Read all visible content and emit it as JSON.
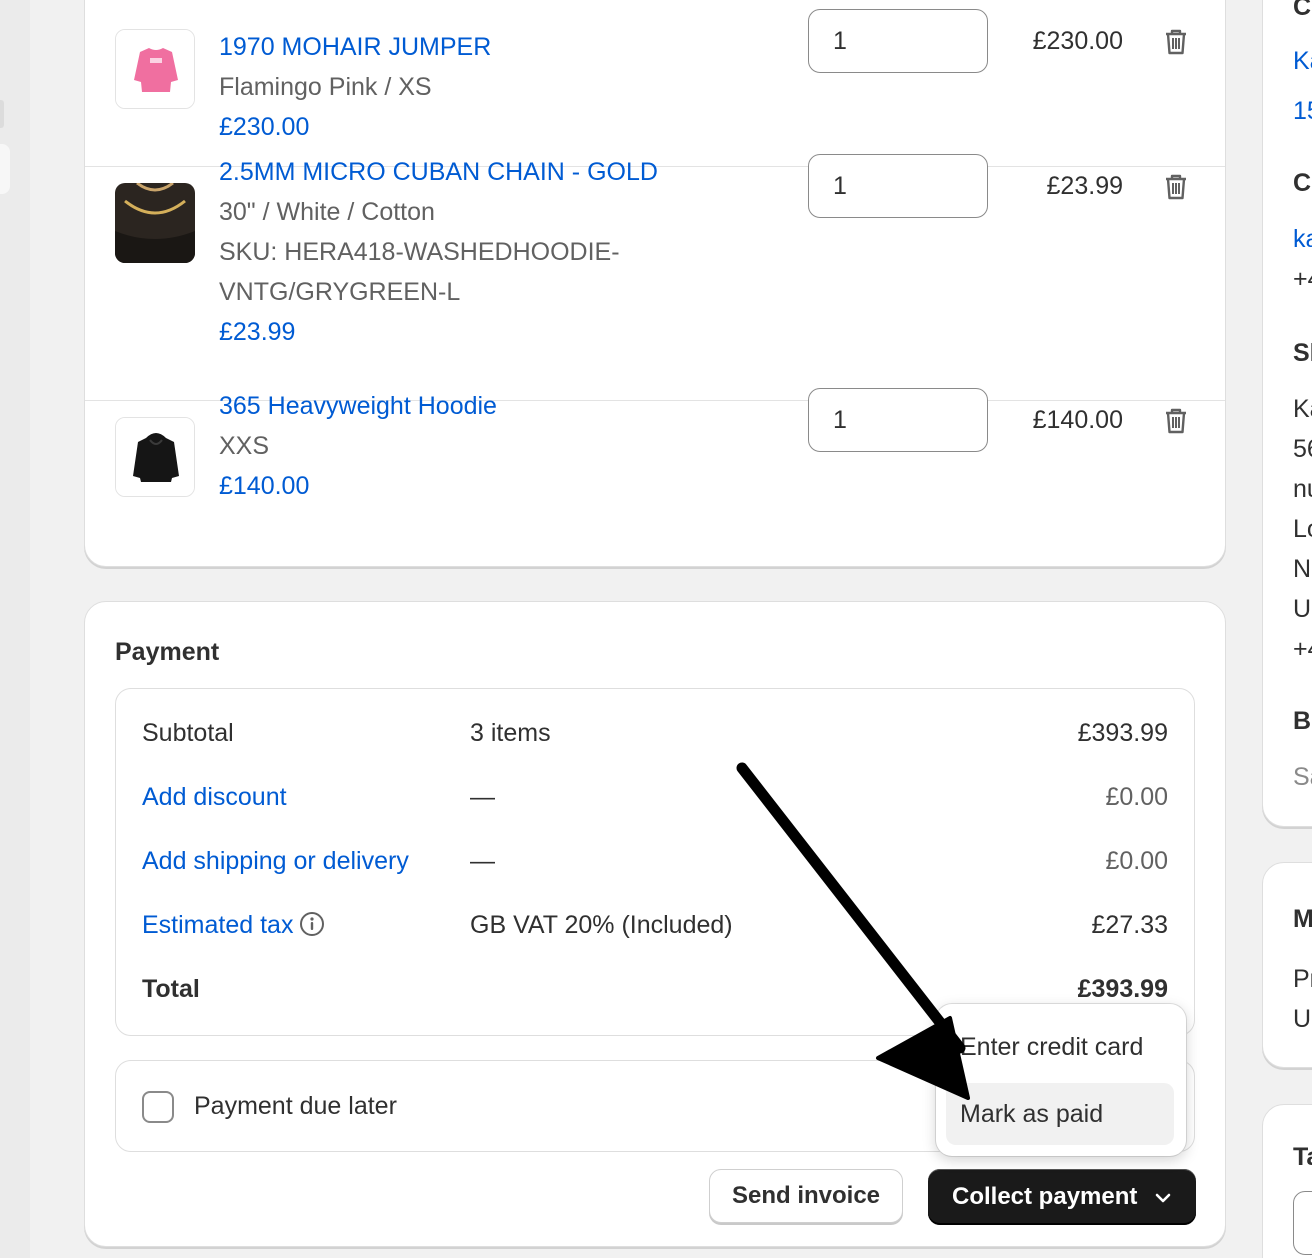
{
  "products": [
    {
      "name": "1970 MOHAIR JUMPER",
      "details": [
        "Flamingo Pink / XS"
      ],
      "unit_price": "£230.00",
      "quantity": "1",
      "line_total": "£230.00",
      "thumb_icon": "pink-jumper-image"
    },
    {
      "name": "2.5MM MICRO CUBAN CHAIN - GOLD",
      "details": [
        "30\" / White / Cotton",
        "SKU: HERA418-WASHEDHOODIE-",
        "VNTG/GRYGREEN-L"
      ],
      "unit_price": "£23.99",
      "quantity": "1",
      "line_total": "£23.99",
      "thumb_icon": "gold-chain-image"
    },
    {
      "name": "365 Heavyweight Hoodie",
      "details": [
        "XXS"
      ],
      "unit_price": "£140.00",
      "quantity": "1",
      "line_total": "£140.00",
      "thumb_icon": "black-hoodie-image"
    }
  ],
  "payment": {
    "title": "Payment",
    "rows": {
      "subtotal": {
        "label": "Subtotal",
        "mid": "3 items",
        "amount": "£393.99"
      },
      "discount": {
        "label": "Add discount",
        "mid": "—",
        "amount": "£0.00"
      },
      "shipping": {
        "label": "Add shipping or delivery",
        "mid": "—",
        "amount": "£0.00"
      },
      "tax": {
        "label": "Estimated tax",
        "mid": "GB VAT 20% (Included)",
        "amount": "£27.33"
      },
      "total": {
        "label": "Total",
        "mid": "",
        "amount": "£393.99"
      }
    },
    "due_later_label": "Payment due later",
    "due_later_checked": false,
    "send_invoice_label": "Send invoice",
    "collect_payment_label": "Collect payment"
  },
  "collect_menu": {
    "items": [
      "Enter credit card",
      "Mark as paid"
    ],
    "highlighted": "Mark as paid"
  },
  "right_column": {
    "card1_lines": [
      "C",
      "Ka",
      "15"
    ],
    "card1_lines_b": [
      "C",
      "ka",
      "+4"
    ],
    "card1_lines_c": [
      "Sh",
      "Ka",
      "56",
      "nu",
      "Lo",
      "N",
      "U",
      "+4"
    ],
    "card1_lines_d": [
      "Bi",
      "Sa"
    ],
    "card2_lines": [
      "M",
      "Pr",
      "U"
    ],
    "card3_lines": [
      "Ta"
    ]
  },
  "colors": {
    "link": "#005bd3",
    "primary_button": "#1a1a1a",
    "page_bg": "#f1f1f1"
  }
}
